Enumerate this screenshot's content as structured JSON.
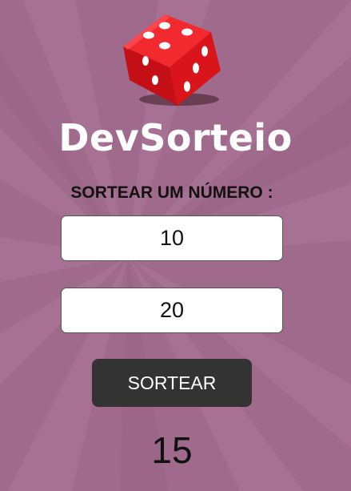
{
  "app": {
    "title": "DevSorteio",
    "subtitle": "SORTEAR UM NÚMERO :"
  },
  "form": {
    "min_value": "10",
    "max_value": "20",
    "button_label": "SORTEAR"
  },
  "result": {
    "value": "15"
  },
  "colors": {
    "background": "#a06a8c",
    "dice": "#e8141c",
    "button": "#333333"
  },
  "icons": {
    "logo": "dice-icon"
  }
}
